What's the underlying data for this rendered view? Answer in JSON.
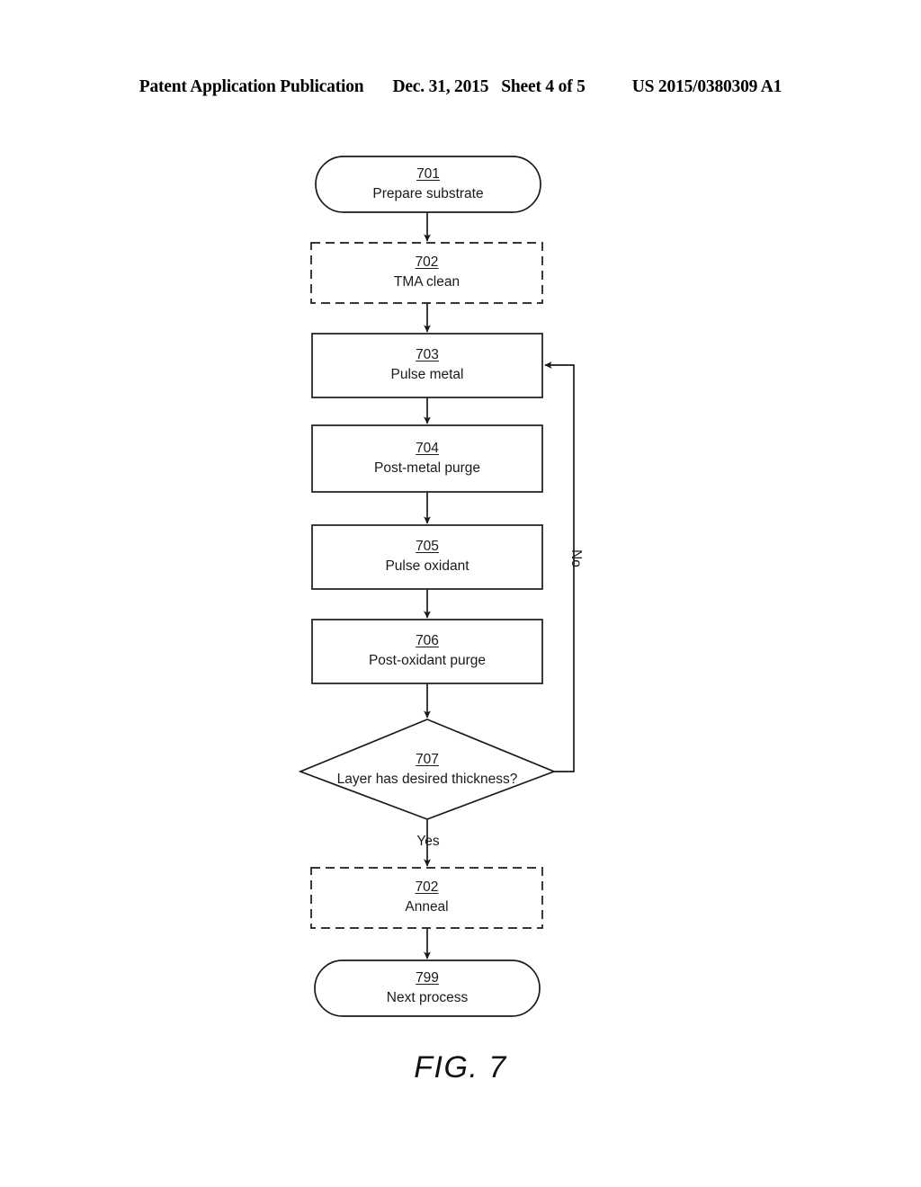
{
  "header": {
    "publication": "Patent Application Publication",
    "date": "Dec. 31, 2015",
    "sheet": "Sheet 4 of 5",
    "patent_number": "US 2015/0380309 A1"
  },
  "figure": {
    "caption": "FIG. 7",
    "nodes": [
      {
        "id": "701",
        "ref": "701",
        "text": "Prepare substrate",
        "shape": "stadium",
        "style": "solid"
      },
      {
        "id": "702a",
        "ref": "702",
        "text": "TMA clean",
        "shape": "rect",
        "style": "dashed"
      },
      {
        "id": "703",
        "ref": "703",
        "text": "Pulse metal",
        "shape": "rect",
        "style": "solid"
      },
      {
        "id": "704",
        "ref": "704",
        "text": "Post-metal purge",
        "shape": "rect",
        "style": "solid"
      },
      {
        "id": "705",
        "ref": "705",
        "text": "Pulse oxidant",
        "shape": "rect",
        "style": "solid"
      },
      {
        "id": "706",
        "ref": "706",
        "text": "Post-oxidant purge",
        "shape": "rect",
        "style": "solid"
      },
      {
        "id": "707",
        "ref": "707",
        "text": "Layer has desired thickness?",
        "shape": "diamond",
        "style": "solid"
      },
      {
        "id": "702b",
        "ref": "702",
        "text": "Anneal",
        "shape": "rect",
        "style": "dashed"
      },
      {
        "id": "799",
        "ref": "799",
        "text": "Next process",
        "shape": "stadium",
        "style": "solid"
      }
    ],
    "edge_labels": {
      "no": "No",
      "yes": "Yes"
    },
    "line_color": "#1a1a1a"
  }
}
